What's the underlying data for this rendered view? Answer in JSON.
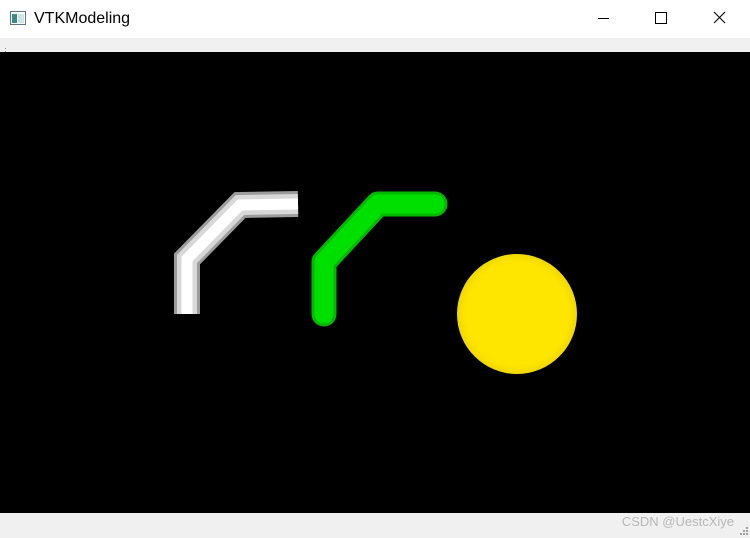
{
  "window": {
    "title": "VTKModeling",
    "app_icon": "window-app-icon",
    "buttons": {
      "minimize_icon": "minimize-icon",
      "maximize_icon": "maximize-icon",
      "close_icon": "close-icon"
    }
  },
  "scene": {
    "background_color": "#000000",
    "objects": [
      {
        "name": "white-tube-polyline",
        "shape": "tube",
        "color": "#ffffff"
      },
      {
        "name": "green-tube-polyline",
        "shape": "tube",
        "color": "#00e000"
      },
      {
        "name": "yellow-sphere",
        "shape": "sphere",
        "color": "#ffe600"
      }
    ]
  },
  "statusbar": {
    "watermark": "CSDN @UestcXiye"
  }
}
